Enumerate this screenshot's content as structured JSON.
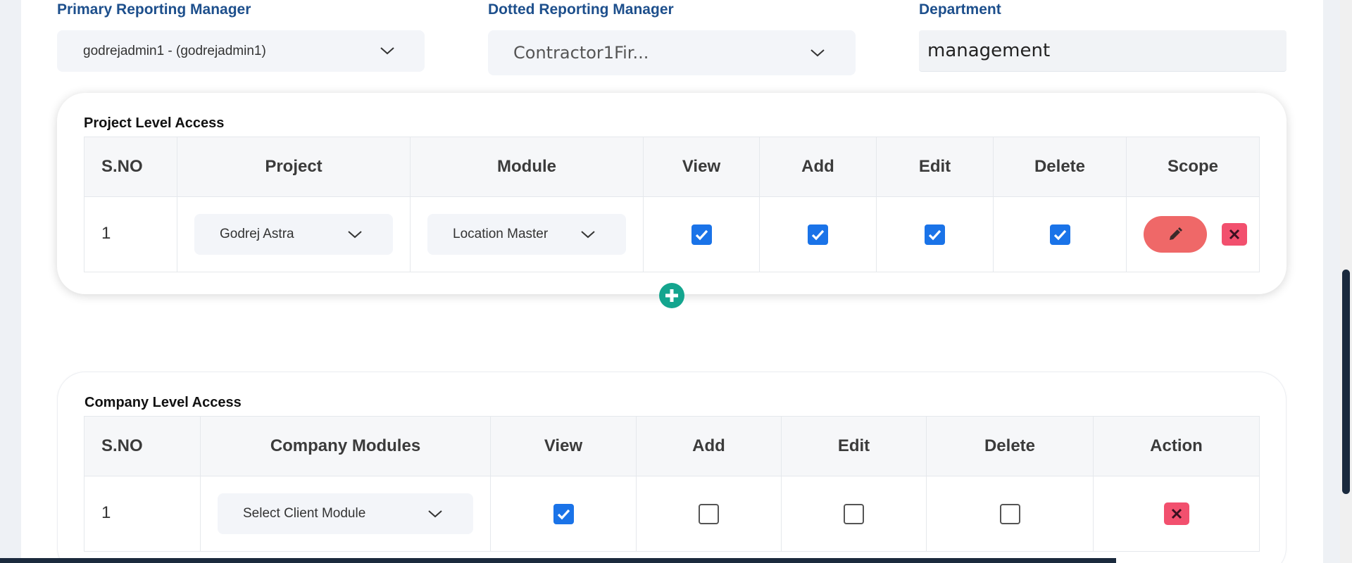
{
  "fields": {
    "primary_manager": {
      "label": "Primary Reporting Manager",
      "value": "godrejadmin1 - (godrejadmin1)"
    },
    "dotted_manager": {
      "label": "Dotted Reporting Manager",
      "value": "Contractor1Fir..."
    },
    "department": {
      "label": "Department",
      "value": "management"
    }
  },
  "project_access": {
    "title": "Project Level Access",
    "headers": [
      "S.NO",
      "Project",
      "Module",
      "View",
      "Add",
      "Edit",
      "Delete",
      "Scope"
    ],
    "rows": [
      {
        "sno": "1",
        "project": "Godrej Astra",
        "module": "Location Master",
        "view": true,
        "add": true,
        "edit": true,
        "delete": true
      }
    ]
  },
  "company_access": {
    "title": "Company Level Access",
    "headers": [
      "S.NO",
      "Company Modules",
      "View",
      "Add",
      "Edit",
      "Delete",
      "Action"
    ],
    "rows": [
      {
        "sno": "1",
        "module": "Select Client Module",
        "view": true,
        "add": false,
        "edit": false,
        "delete": false
      }
    ]
  },
  "colors": {
    "label_blue": "#1d4f8c",
    "checkbox_blue": "#1a73e8",
    "edit_red": "#ef6868",
    "delete_pink": "#f2506e",
    "add_green": "#14a58e"
  },
  "icons": {
    "dropdown": "chevron-down-icon",
    "edit": "pencil-icon",
    "delete": "close-icon",
    "add": "plus-circle-icon",
    "checked": "checkbox-checked-icon",
    "unchecked": "checkbox-unchecked-icon"
  }
}
